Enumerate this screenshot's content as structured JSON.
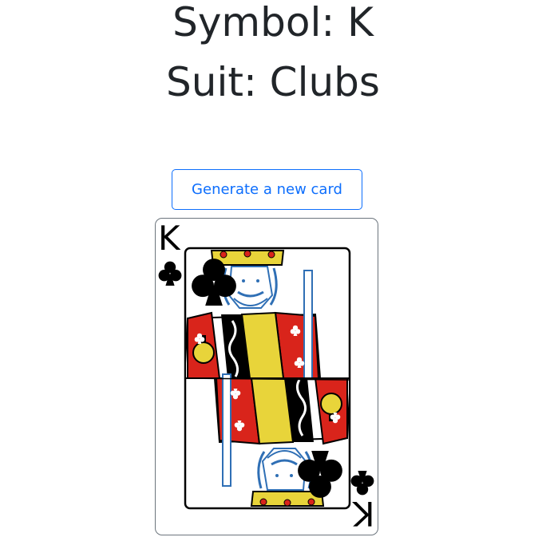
{
  "header": {
    "symbol_line": "Symbol: K",
    "suit_line": "Suit: Clubs"
  },
  "actions": {
    "generate_label": "Generate a new card"
  },
  "card": {
    "rank": "K",
    "suit": "clubs",
    "suit_icon": "club-icon",
    "colors": {
      "ink": "#000000",
      "red": "#d9241b",
      "gold": "#e8d43a",
      "blue": "#2f6fb5",
      "button_accent": "#0d6efd"
    }
  }
}
